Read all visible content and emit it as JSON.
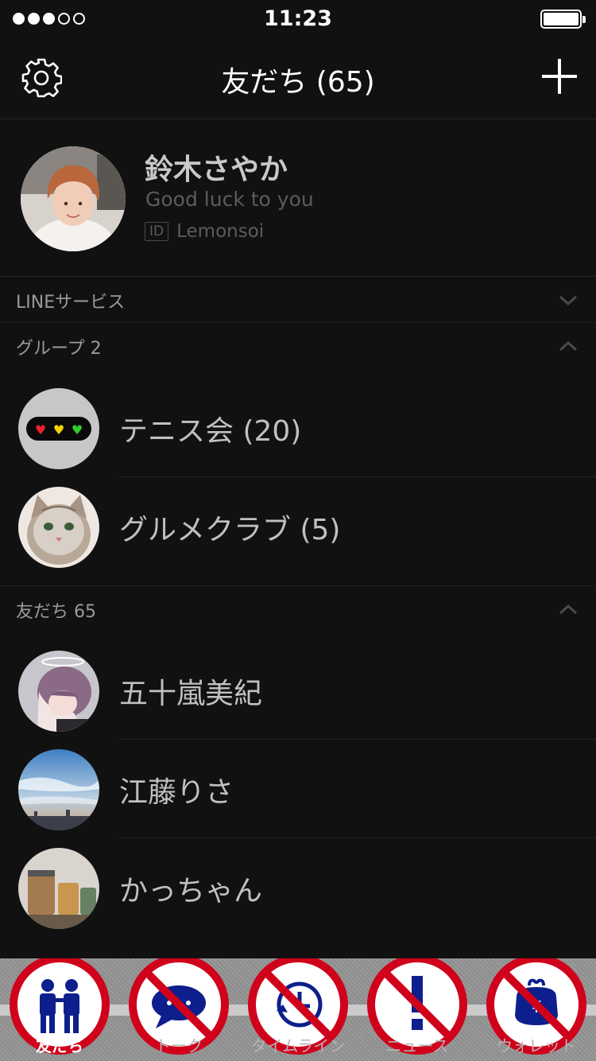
{
  "status_bar": {
    "time": "11:23"
  },
  "nav": {
    "title": "友だち (65)"
  },
  "profile": {
    "name": "鈴木さやか",
    "status_message": "Good luck to you",
    "id_badge": "ID",
    "id_value": "Lemonsoi"
  },
  "sections": {
    "line_services": "LINEサービス",
    "groups": "グループ 2",
    "friends": "友だち 65"
  },
  "groups": [
    {
      "name": "テニス会 (20)"
    },
    {
      "name": "グルメクラブ (5)"
    }
  ],
  "friends": [
    {
      "name": "五十嵐美紀"
    },
    {
      "name": "江藤りさ"
    },
    {
      "name": "かっちゃん"
    }
  ],
  "tabs": [
    {
      "label": "友だち",
      "icon": "friends-icon",
      "active": true
    },
    {
      "label": "トーク",
      "icon": "chat-bubble-icon"
    },
    {
      "label": "タイムライン",
      "icon": "clock-icon"
    },
    {
      "label": "ニュース",
      "icon": "exclamation-icon"
    },
    {
      "label": "ウォレット",
      "icon": "wallet-icon"
    }
  ],
  "colors": {
    "background": "#111111",
    "prohibition_red": "#d0021b",
    "icon_navy": "#0d1f8c"
  }
}
